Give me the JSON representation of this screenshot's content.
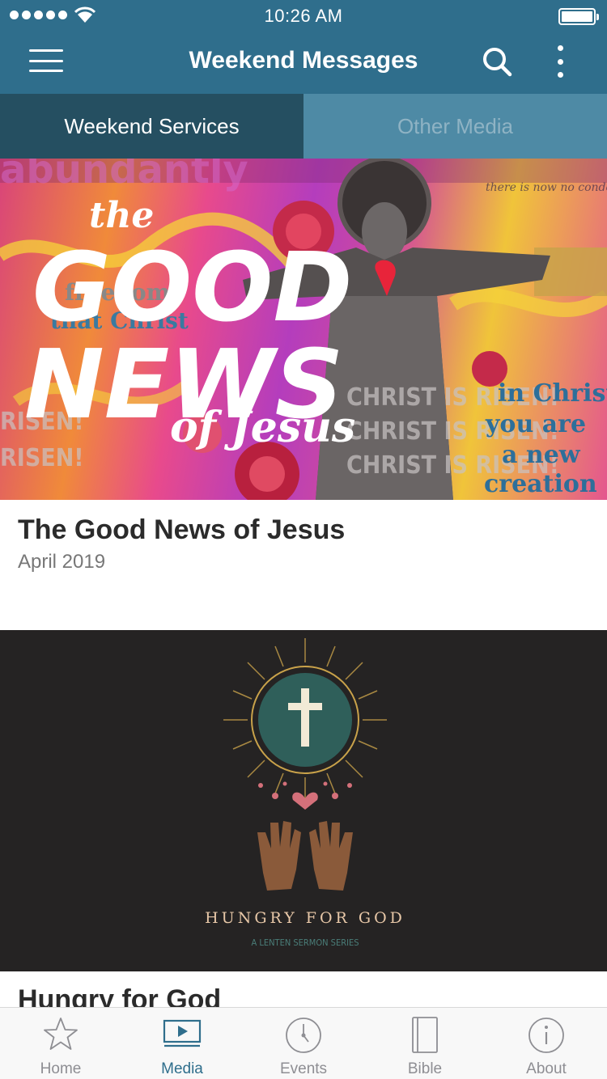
{
  "status_bar": {
    "time": "10:26 AM"
  },
  "header": {
    "title": "Weekend Messages",
    "menu_icon": "hamburger-menu-icon",
    "search_icon": "search-icon",
    "more_icon": "more-vertical-icon"
  },
  "tabs": [
    {
      "label": "Weekend Services",
      "active": true
    },
    {
      "label": "Other Media",
      "active": false
    }
  ],
  "cards": [
    {
      "title": "The Good News of Jesus",
      "subtitle": "April 2019",
      "art_text": {
        "the": "the",
        "good": "GOOD",
        "news": "NEWS",
        "of_jesus": "of Jesus",
        "risen_line": "CHRIST IS RISEN!",
        "risen_left": "RISEN!",
        "verse": [
          "in Christ",
          "you are",
          "a new",
          "creation"
        ],
        "freedom": "freedom",
        "that_christ": "that Christ",
        "scribble": "there is now no condemnation for those who are in Christ Jesus",
        "top": "abundantly"
      }
    },
    {
      "title": "Hungry for God",
      "art_text": {
        "title": "HUNGRY FOR GOD",
        "subtitle": "A LENTEN SERMON SERIES"
      }
    }
  ],
  "tab_bar": [
    {
      "label": "Home",
      "icon": "star-icon",
      "active": false
    },
    {
      "label": "Media",
      "icon": "media-play-icon",
      "active": true
    },
    {
      "label": "Events",
      "icon": "clock-icon",
      "active": false
    },
    {
      "label": "Bible",
      "icon": "book-icon",
      "active": false
    },
    {
      "label": "About",
      "icon": "info-icon",
      "active": false
    }
  ],
  "colors": {
    "header": "#2f6e8c",
    "tab_active": "#254f61",
    "tab_inactive": "#4e8aa5",
    "tabbar_active": "#2f6e8c",
    "tabbar_inactive": "#8e8e93"
  }
}
